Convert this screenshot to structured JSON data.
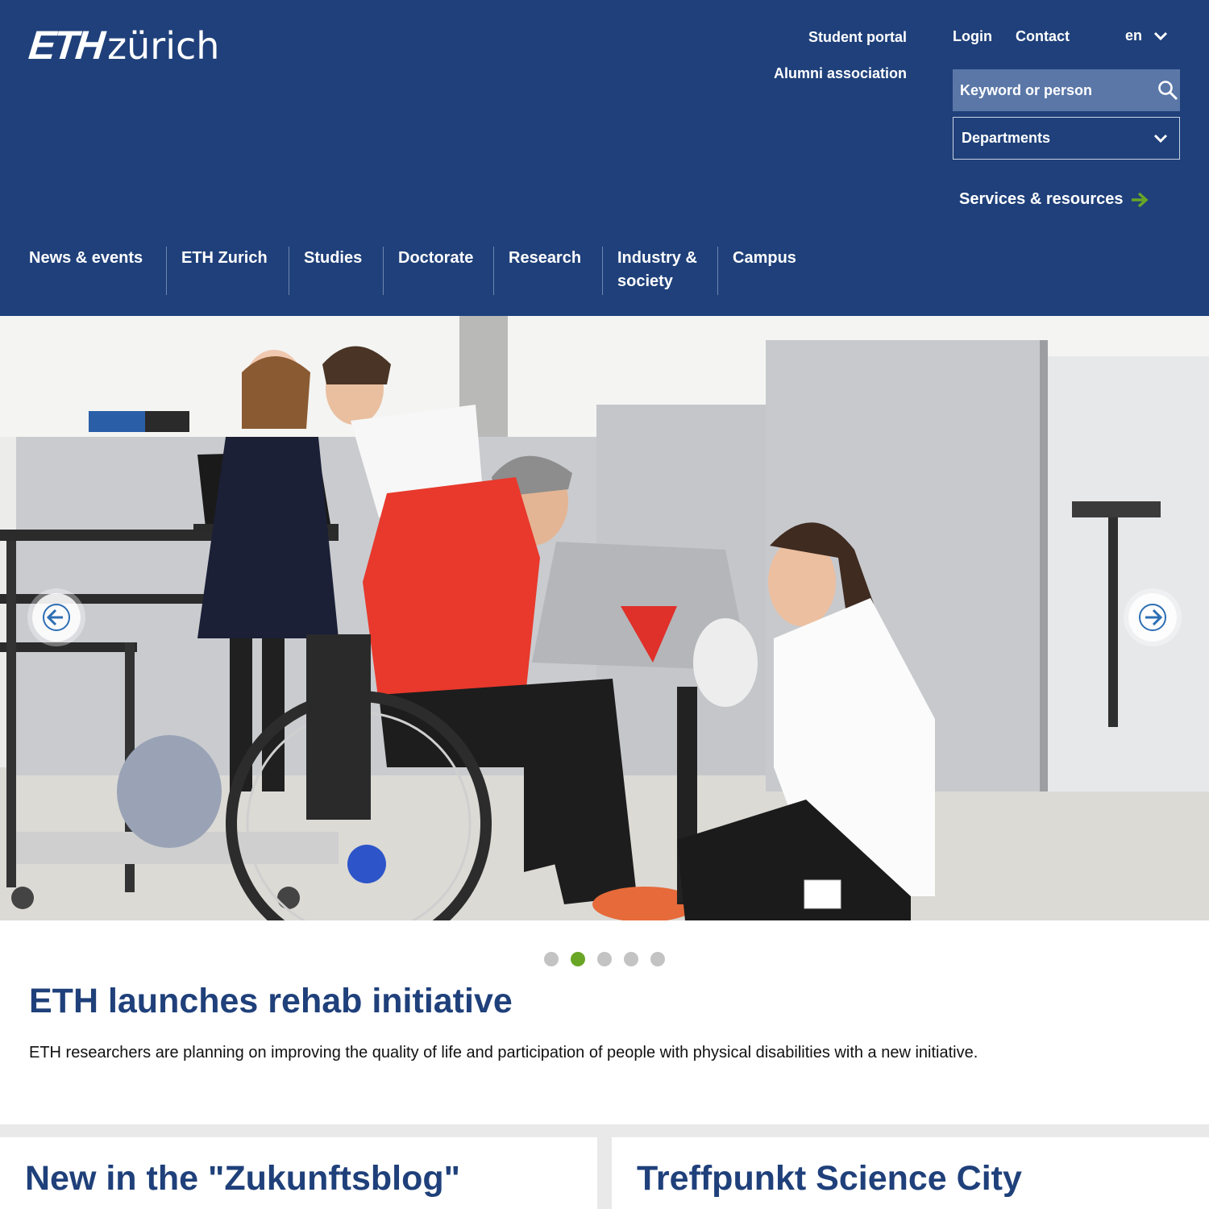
{
  "header": {
    "logo_bold": "ETH",
    "logo_light": "zürich",
    "links": {
      "student_portal": "Student portal",
      "alumni": "Alumni association",
      "login": "Login",
      "contact": "Contact"
    },
    "language": "en",
    "search_placeholder": "Keyword or person",
    "departments_label": "Departments",
    "services_label": "Services & resources"
  },
  "nav": {
    "items": [
      {
        "line1": "News & events",
        "line2": ""
      },
      {
        "line1": "ETH Zurich",
        "line2": ""
      },
      {
        "line1": "Studies",
        "line2": ""
      },
      {
        "line1": "Doctorate",
        "line2": ""
      },
      {
        "line1": "Research",
        "line2": ""
      },
      {
        "line1": "Industry &",
        "line2": "society"
      },
      {
        "line1": "Campus",
        "line2": ""
      }
    ]
  },
  "carousel": {
    "slide_count": 5,
    "active_index": 1,
    "headline": "ETH launches rehab initiative",
    "teaser": "ETH researchers are planning on improving the quality of life and participation of people with physical disabilities with a new initiative."
  },
  "cards": [
    {
      "title": "New in the \"Zukunftsblog\""
    },
    {
      "title": "Treffpunkt Science City"
    }
  ],
  "colors": {
    "brand_blue": "#1f407a",
    "accent_green": "#6aa626",
    "search_bg": "#5a77a8"
  },
  "icons": {
    "search": "search-icon",
    "chevron": "chevron-down-icon",
    "services_arrow": "arrow-right-icon",
    "prev": "arrow-left-icon",
    "next": "arrow-right-icon"
  }
}
